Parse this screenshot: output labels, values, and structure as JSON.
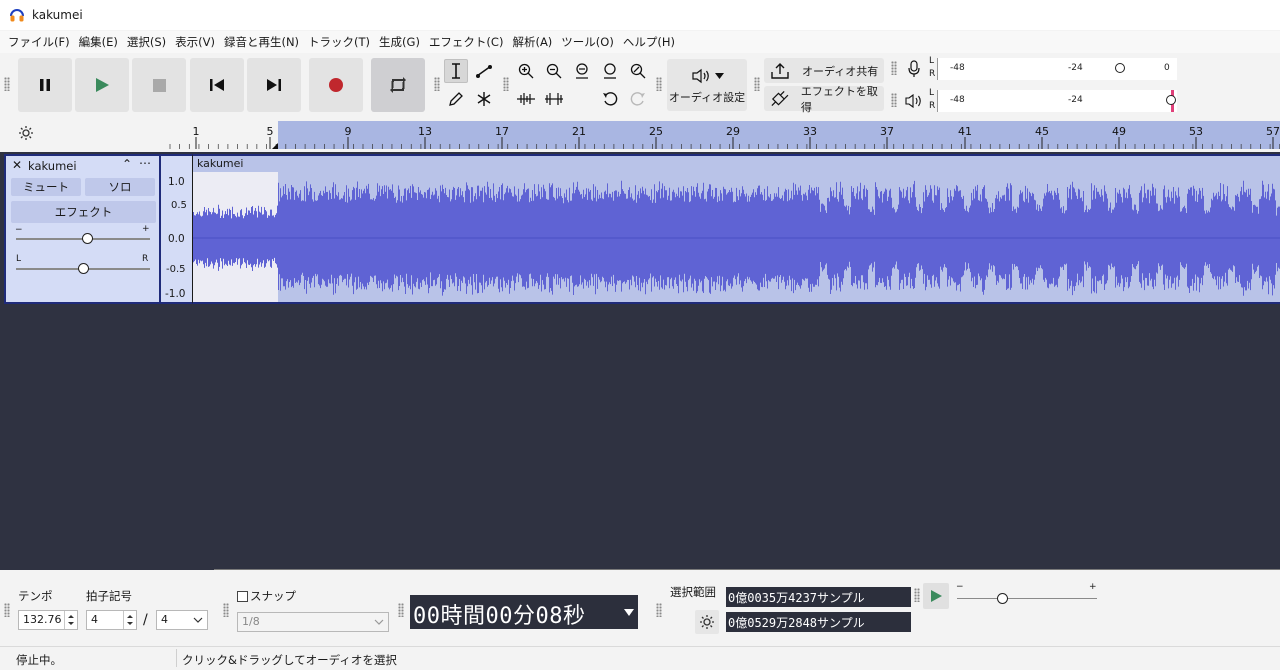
{
  "window": {
    "title": "kakumei"
  },
  "menu": [
    "ファイル(F)",
    "編集(E)",
    "選択(S)",
    "表示(V)",
    "録音と再生(N)",
    "トラック(T)",
    "生成(G)",
    "エフェクト(C)",
    "解析(A)",
    "ツール(O)",
    "ヘルプ(H)"
  ],
  "toolbar": {
    "audio_setup_label": "オーディオ設定",
    "share_audio_label": "オーディオ共有",
    "get_effects_label": "エフェクトを取得",
    "meter_ticks": [
      "-48",
      "-24",
      "0"
    ],
    "meter_channels": [
      "L",
      "R"
    ]
  },
  "ruler": {
    "ticks": [
      "1",
      "5",
      "9",
      "13",
      "17",
      "21",
      "25",
      "29",
      "33",
      "37",
      "41",
      "45",
      "49",
      "53",
      "57"
    ]
  },
  "track": {
    "name": "kakumei",
    "mute_label": "ミュート",
    "solo_label": "ソロ",
    "effects_label": "エフェクト",
    "gain_minus": "−",
    "gain_plus": "+",
    "pan_left": "L",
    "pan_right": "R",
    "clip_name": "kakumei",
    "scale": [
      "1.0",
      "0.5",
      "0.0",
      "-0.5",
      "-1.0"
    ]
  },
  "bottom": {
    "tempo_label": "テンポ",
    "tempo_value": "132.76",
    "time_sig_label": "拍子記号",
    "time_sig_num": "4",
    "time_sig_sep": "/",
    "time_sig_den": "4",
    "snap_label": "スナップ",
    "snap_value": "1/8",
    "time_display": "00時間00分08秒",
    "selection_label": "選択範囲",
    "selection_start": "0億0035万4237サンプル",
    "selection_end": "0億0529万2848サンプル",
    "play_speed_minus": "−",
    "play_speed_plus": "+"
  },
  "status": {
    "state": "停止中。",
    "hint": "クリック&ドラッグしてオーディオを選択"
  },
  "colors": {
    "waveform": "#5f63d4",
    "selection_bg": "#b9c3e8",
    "record": "#c0272d",
    "play": "#3a8a5c",
    "canvas_bg": "#2f3241"
  }
}
